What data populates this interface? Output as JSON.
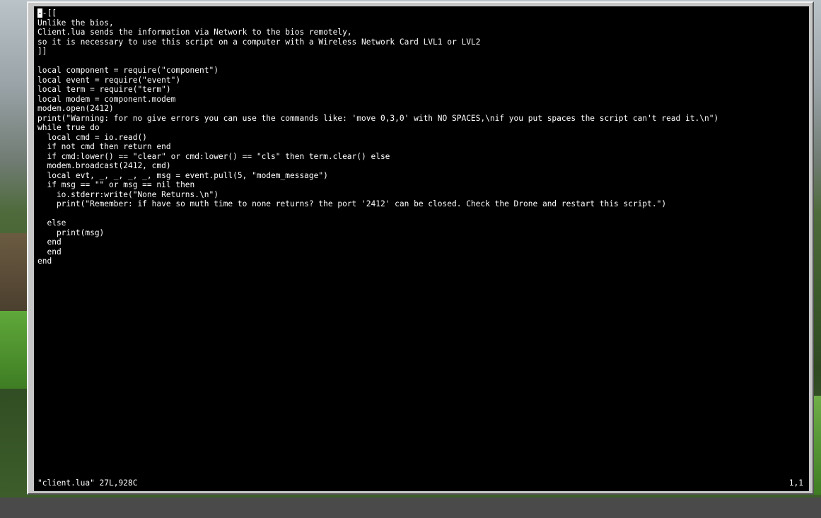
{
  "editor": {
    "cursor_char": "-",
    "first_line_rest": "-[[",
    "lines": [
      "Unlike the bios,",
      "Client.lua sends the information via Network to the bios remotely,",
      "so it is necessary to use this script on a computer with a Wireless Network Card LVL1 or LVL2",
      "]]",
      "",
      "local component = require(\"component\")",
      "local event = require(\"event\")",
      "local term = require(\"term\")",
      "local modem = component.modem",
      "modem.open(2412)",
      "print(\"Warning: for no give errors you can use the commands like: 'move 0,3,0' with NO SPACES,\\nif you put spaces the script can't read it.\\n\")",
      "while true do",
      "  local cmd = io.read()",
      "  if not cmd then return end",
      "  if cmd:lower() == \"clear\" or cmd:lower() == \"cls\" then term.clear() else",
      "  modem.broadcast(2412, cmd)",
      "  local evt, _, _, _, _, msg = event.pull(5, \"modem_message\")",
      "  if msg == \"\" or msg == nil then",
      "    io.stderr:write(\"None Returns.\\n\")",
      "    print(\"Remember: if have so muth time to none returns? the port '2412' can be closed. Check the Drone and restart this script.\")",
      "",
      "  else",
      "    print(msg)",
      "  end",
      "  end",
      "end"
    ]
  },
  "status": {
    "file_info": "\"client.lua\" 27L,928C",
    "position": "1,1"
  }
}
